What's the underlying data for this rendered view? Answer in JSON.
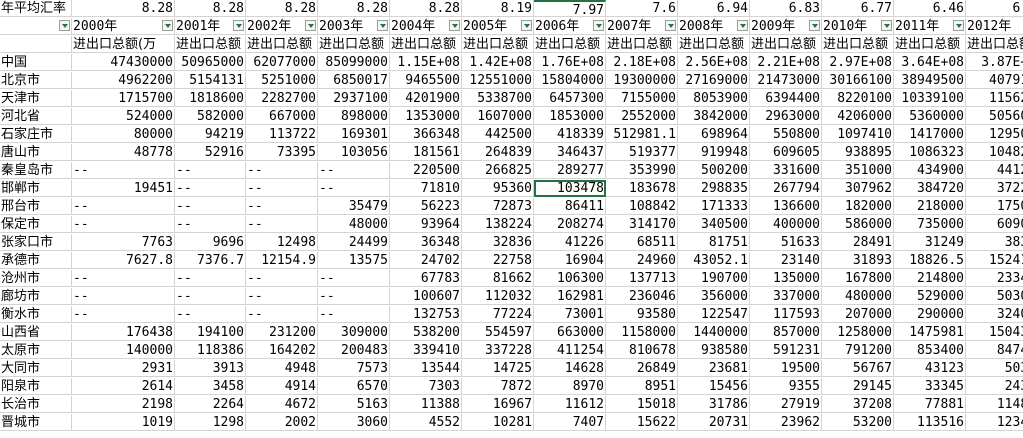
{
  "sheet": {
    "rate_label": "年平均汇率",
    "rates": [
      "8.28",
      "8.28",
      "8.28",
      "8.28",
      "8.28",
      "8.19",
      "7.97",
      "7.6",
      "6.94",
      "6.83",
      "6.77",
      "6.46",
      "6.3"
    ],
    "years": [
      "2000年",
      "2001年",
      "2002年",
      "2003年",
      "2004年",
      "2005年",
      "2006年",
      "2007年",
      "2008年",
      "2009年",
      "2010年",
      "2011年",
      "2012年"
    ],
    "metric_label": "进出口总额(万",
    "metric_truncated": "进出口总额",
    "rows": [
      {
        "region": "中国",
        "values": [
          "47430000",
          "50965000",
          "62077000",
          "85099000",
          "1.15E+08",
          "1.42E+08",
          "1.76E+08",
          "2.18E+08",
          "2.56E+08",
          "2.21E+08",
          "2.97E+08",
          "3.64E+08",
          "3.87E+0"
        ]
      },
      {
        "region": "北京市",
        "values": [
          "4962200",
          "5154131",
          "5251000",
          "6850017",
          "9465500",
          "12551000",
          "15804000",
          "19300000",
          "27169000",
          "21473000",
          "30166100",
          "38949500",
          "407916"
        ]
      },
      {
        "region": "天津市",
        "values": [
          "1715700",
          "1818600",
          "2282700",
          "2937100",
          "4201900",
          "5338700",
          "6457300",
          "7155000",
          "8053900",
          "6394400",
          "8220100",
          "10339100",
          "115623"
        ]
      },
      {
        "region": "河北省",
        "values": [
          "524000",
          "582000",
          "667000",
          "898000",
          "1353000",
          "1607000",
          "1853000",
          "2552000",
          "3842000",
          "2963000",
          "4206000",
          "5360000",
          "505600"
        ]
      },
      {
        "region": "石家庄市",
        "values": [
          "80000",
          "94219",
          "113722",
          "169301",
          "366348",
          "442500",
          "418339",
          "512981.1",
          "698964",
          "550800",
          "1097410",
          "1417000",
          "129500"
        ]
      },
      {
        "region": "唐山市",
        "values": [
          "48778",
          "52916",
          "73395",
          "103056",
          "181561",
          "264839",
          "346437",
          "519377",
          "919948",
          "609605",
          "938895",
          "1086323",
          "104824"
        ]
      },
      {
        "region": "秦皇岛市",
        "values": [
          "--",
          "--",
          "--",
          "--",
          "220500",
          "266825",
          "289277",
          "353990",
          "500200",
          "331600",
          "351000",
          "434900",
          "44120"
        ]
      },
      {
        "region": "邯郸市",
        "values": [
          "19451",
          "--",
          "--",
          "--",
          "71810",
          "95360",
          "103478",
          "183678",
          "298835",
          "267794",
          "307962",
          "384720",
          "37225"
        ]
      },
      {
        "region": "邢台市",
        "values": [
          "--",
          "--",
          "--",
          "35479",
          "56223",
          "72873",
          "86411",
          "108842",
          "171333",
          "136600",
          "182000",
          "218000",
          "17500"
        ]
      },
      {
        "region": "保定市",
        "values": [
          "--",
          "--",
          "--",
          "48000",
          "93964",
          "138224",
          "208274",
          "314170",
          "340500",
          "400000",
          "586000",
          "735000",
          "60900"
        ]
      },
      {
        "region": "张家口市",
        "values": [
          "7763",
          "9696",
          "12498",
          "24499",
          "36348",
          "32836",
          "41226",
          "68511",
          "81751",
          "51633",
          "28491",
          "31249",
          "3836"
        ]
      },
      {
        "region": "承德市",
        "values": [
          "7627.8",
          "7376.7",
          "12154.9",
          "13575",
          "24702",
          "22758",
          "16904",
          "24960",
          "43052.1",
          "23140",
          "31893",
          "18826.5",
          "15241."
        ]
      },
      {
        "region": "沧州市",
        "values": [
          "--",
          "--",
          "--",
          "--",
          "67783",
          "81662",
          "106300",
          "137713",
          "190700",
          "135000",
          "167800",
          "214800",
          "23340"
        ]
      },
      {
        "region": "廊坊市",
        "values": [
          "--",
          "--",
          "--",
          "--",
          "100607",
          "112032",
          "162981",
          "236046",
          "356000",
          "337000",
          "480000",
          "529000",
          "50300"
        ]
      },
      {
        "region": "衡水市",
        "values": [
          "--",
          "--",
          "--",
          "--",
          "132753",
          "77224",
          "73001",
          "93580",
          "122547",
          "117593",
          "207000",
          "290000",
          "32400"
        ]
      },
      {
        "region": "山西省",
        "values": [
          "176438",
          "194100",
          "231200",
          "309000",
          "538200",
          "554597",
          "663000",
          "1158000",
          "1440000",
          "857000",
          "1258000",
          "1475981",
          "150432"
        ]
      },
      {
        "region": "太原市",
        "values": [
          "140000",
          "118386",
          "164202",
          "200483",
          "339410",
          "337228",
          "411254",
          "810678",
          "938580",
          "591231",
          "791200",
          "853400",
          "84740"
        ]
      },
      {
        "region": "大同市",
        "values": [
          "2931",
          "3913",
          "4948",
          "7573",
          "13544",
          "14725",
          "14628",
          "26849",
          "23681",
          "19500",
          "56767",
          "43123",
          "5039"
        ]
      },
      {
        "region": "阳泉市",
        "values": [
          "2614",
          "3458",
          "4914",
          "6570",
          "7303",
          "7872",
          "8970",
          "8951",
          "15456",
          "9355",
          "29145",
          "33345",
          "2435"
        ]
      },
      {
        "region": "长治市",
        "values": [
          "2198",
          "2264",
          "4672",
          "5163",
          "11388",
          "16967",
          "11612",
          "15018",
          "31786",
          "27919",
          "37208",
          "77881",
          "11489"
        ]
      },
      {
        "region": "晋城市",
        "values": [
          "1019",
          "1298",
          "2002",
          "3060",
          "4552",
          "10281",
          "7407",
          "15622",
          "20731",
          "23962",
          "53200",
          "113516",
          "12349"
        ]
      }
    ]
  }
}
